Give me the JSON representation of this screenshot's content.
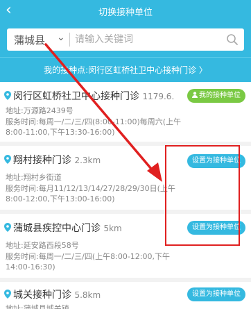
{
  "header": {
    "title": "切换接种单位",
    "back_icon": "chevron-left-icon"
  },
  "search": {
    "city": "蒲城县",
    "placeholder": "请输入关键词"
  },
  "current_unit": {
    "text": "我的接种点:闵行区虹桥社卫中心接种门诊 〉"
  },
  "units": [
    {
      "name": "闵行区虹桥社卫中心接种门诊",
      "distance": "1179.6.",
      "address": "地址:万源路2439号",
      "hours": "服务时间:每周一/二/三/四(8:00-11:00)每周六(上午8:00-11:00,下午13:30-16:00)",
      "button": "我的接种单位",
      "button_type": "current"
    },
    {
      "name": "翔村接种门诊",
      "distance": "2.3km",
      "address": "地址:翔村乡街道",
      "hours": "服务时间:每月11/12/13/14/27/28/29/30日(上午8:00-12:00,下午13:00-16:00)",
      "button": "设置为接种单位",
      "button_type": "set"
    },
    {
      "name": "蒲城县疾控中心门诊",
      "distance": "5km",
      "address": "地址:延安路西段58号",
      "hours": "服务时间:每周一/二/三/四(上午8:00-12:00,下午14:00-16:30)",
      "button": "设置为接种单位",
      "button_type": "set"
    },
    {
      "name": "城关接种门诊",
      "distance": "5.8km",
      "address": "地址:蒲城县城关镇",
      "hours": "",
      "button": "设置为接种单位",
      "button_type": "set"
    }
  ],
  "colors": {
    "accent": "#35b9e0",
    "green": "#7ac943",
    "annotation_red": "#e02020"
  }
}
